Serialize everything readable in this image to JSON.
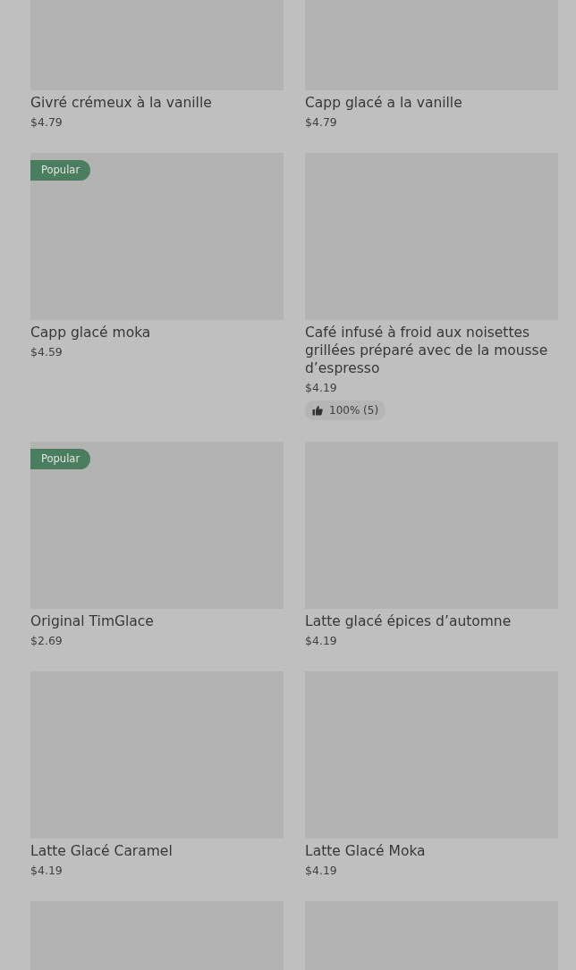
{
  "products": [
    {
      "kind": "product",
      "name": "Givré crémeux à la vanille",
      "price": "$4.79"
    },
    {
      "kind": "product",
      "name": "Capp glacé a la vanille",
      "price": "$4.79"
    },
    {
      "kind": "product",
      "badge": "Popular",
      "name": "Capp glacé moka",
      "price": "$4.59"
    },
    {
      "kind": "product",
      "name": "Café infusé à froid aux noisettes grillées préparé avec de la mousse d’espresso",
      "price": "$4.19",
      "rating": "100% (5)"
    },
    {
      "kind": "product",
      "badge": "Popular",
      "name": "Original TimGlace",
      "price": "$2.69"
    },
    {
      "kind": "product",
      "name": "Latte glacé épices d’automne",
      "price": "$4.19"
    },
    {
      "kind": "product",
      "name": "Latte Glacé Caramel",
      "price": "$4.19"
    },
    {
      "kind": "product",
      "name": "Latte Glacé Moka",
      "price": "$4.19"
    },
    {
      "kind": "picture"
    },
    {
      "kind": "picture"
    }
  ]
}
